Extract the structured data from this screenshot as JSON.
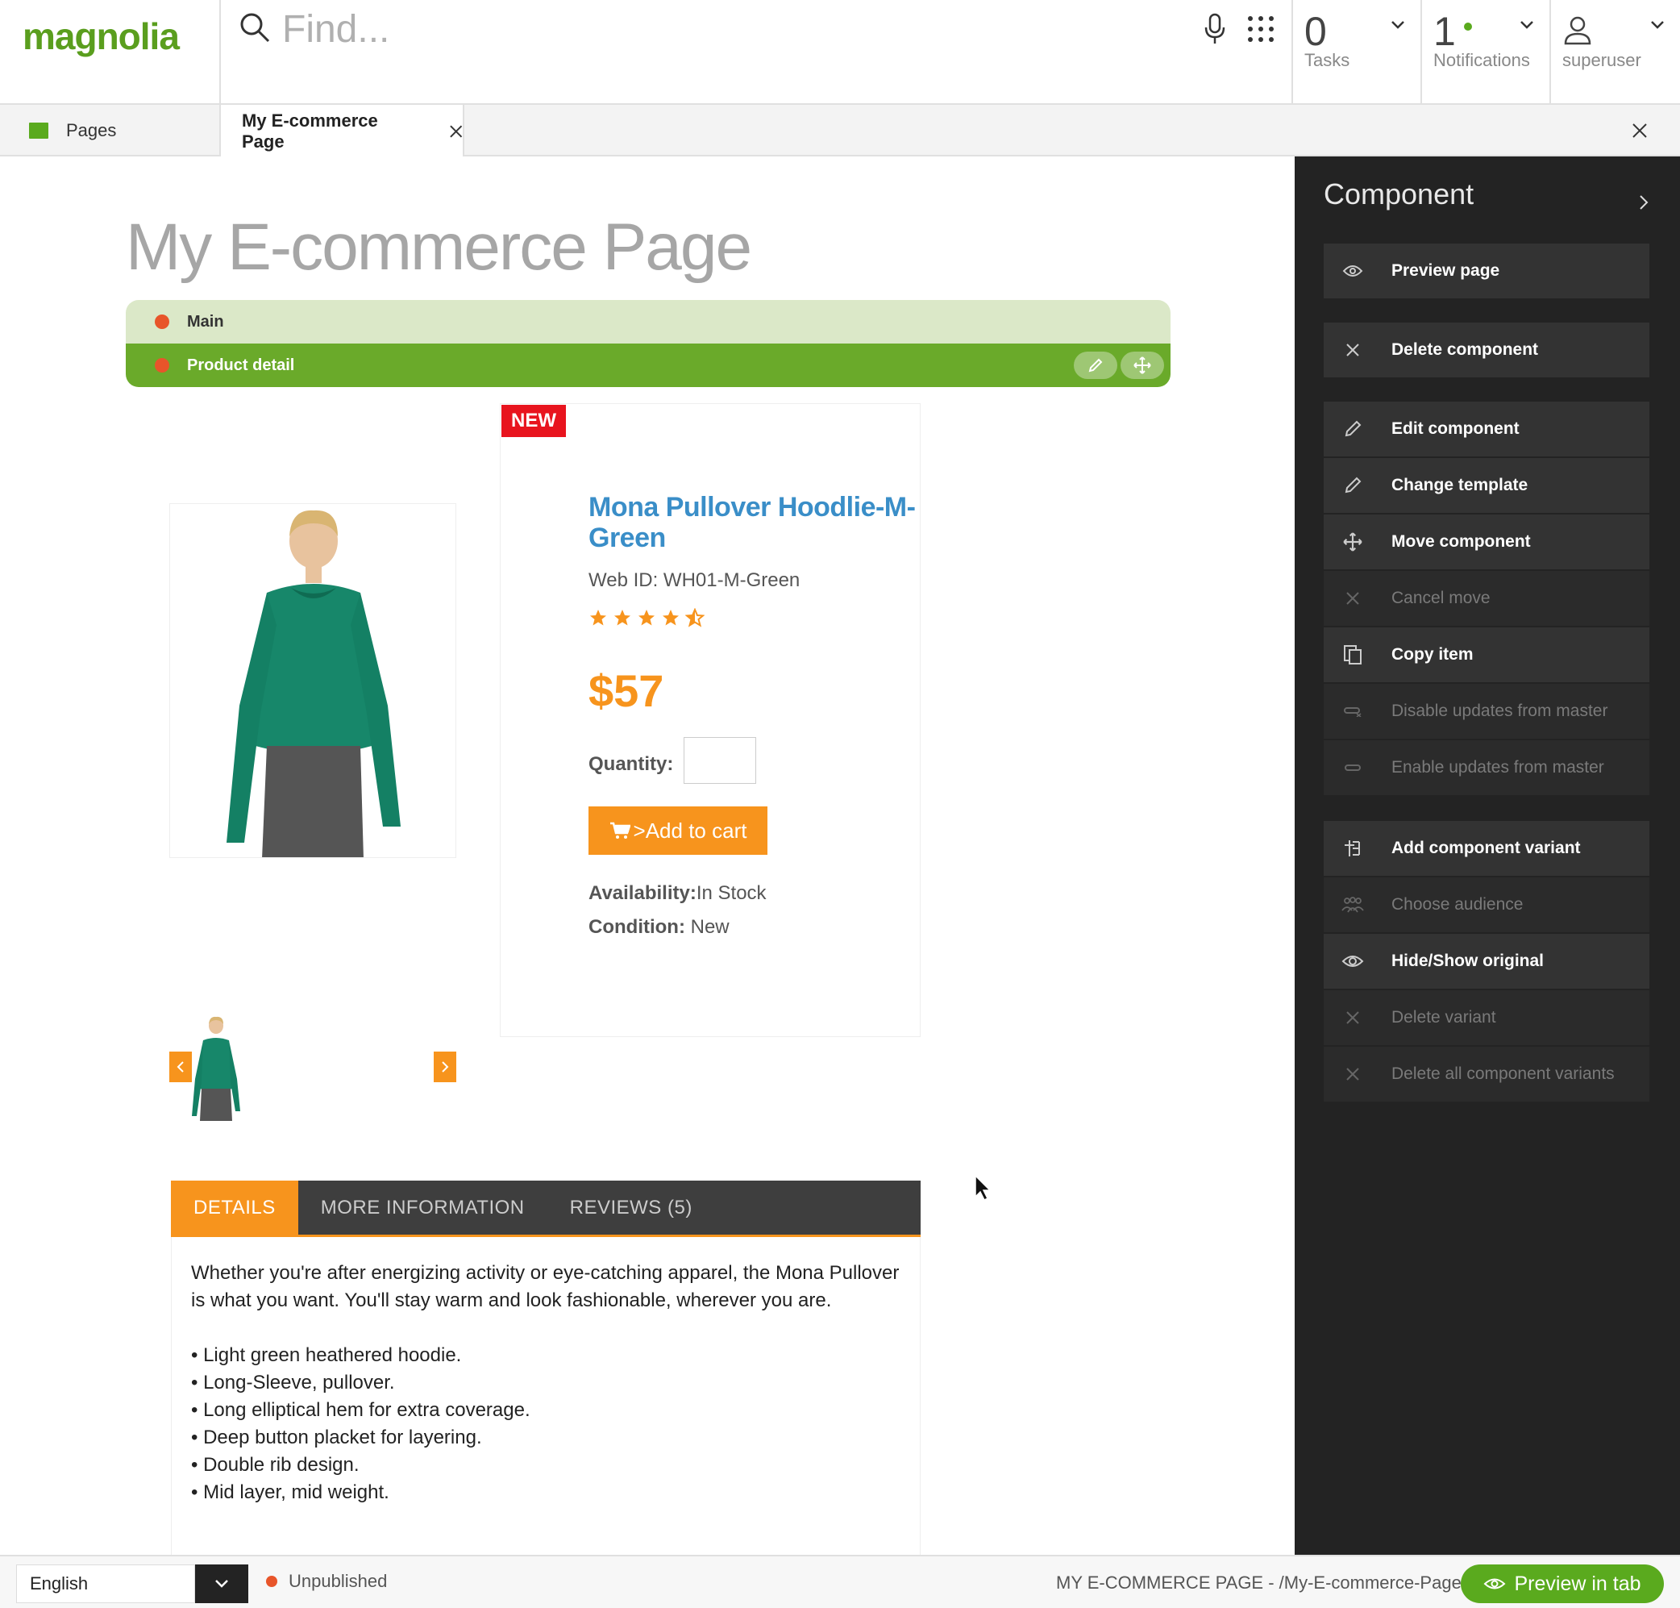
{
  "topbar": {
    "logo": "magnolia",
    "search_placeholder": "Find...",
    "tasks": {
      "count": "0",
      "label": "Tasks"
    },
    "notifications": {
      "count": "1",
      "label": "Notifications"
    },
    "user": {
      "label": "superuser"
    }
  },
  "tabs": {
    "pages_label": "Pages",
    "active_label": "My E-commerce Page"
  },
  "page": {
    "title": "My E-commerce Page",
    "area_label": "Main",
    "component_label": "Product detail",
    "badge": "NEW",
    "product_name": "Mona Pullover Hoodlie-M-Green",
    "web_id": "Web ID: WH01-M-Green",
    "rating": 4.5,
    "price": "$57",
    "quantity_label": "Quantity:",
    "quantity_value": "",
    "add_to_cart": ">Add to cart",
    "availability_label": "Availability:",
    "availability_value": "In Stock",
    "condition_label": "Condition:",
    "condition_value": "New",
    "product_tabs": [
      "DETAILS",
      "MORE INFORMATION",
      "REVIEWS (5)"
    ],
    "description": "Whether you're after energizing activity or eye-catching apparel, the Mona Pullover is what you want. You'll stay warm and look fashionable, wherever you are.",
    "features": [
      "Light green heathered hoodie.",
      "Long-Sleeve, pullover.",
      "Long elliptical hem for extra coverage.",
      "Deep button placket for layering.",
      "Double rib design.",
      "Mid layer, mid weight."
    ]
  },
  "panel": {
    "title": "Component",
    "actions": [
      {
        "label": "Preview page",
        "icon": "preview-icon",
        "enabled": true
      },
      {
        "label": "Delete component",
        "icon": "close-icon",
        "enabled": true
      },
      {
        "label": "Edit component",
        "icon": "pencil-icon",
        "enabled": true
      },
      {
        "label": "Change template",
        "icon": "pencil-icon",
        "enabled": true
      },
      {
        "label": "Move component",
        "icon": "move-icon",
        "enabled": true
      },
      {
        "label": "Cancel move",
        "icon": "close-icon",
        "enabled": false
      },
      {
        "label": "Copy item",
        "icon": "copy-icon",
        "enabled": true
      },
      {
        "label": "Disable updates from master",
        "icon": "unlink-icon",
        "enabled": false
      },
      {
        "label": "Enable updates from master",
        "icon": "link-icon",
        "enabled": false
      },
      {
        "label": "Add component variant",
        "icon": "add-variant-icon",
        "enabled": true
      },
      {
        "label": "Choose audience",
        "icon": "audience-icon",
        "enabled": false
      },
      {
        "label": "Hide/Show original",
        "icon": "eye-icon",
        "enabled": true
      },
      {
        "label": "Delete variant",
        "icon": "close-icon",
        "enabled": false
      },
      {
        "label": "Delete all component variants",
        "icon": "close-icon",
        "enabled": false
      }
    ]
  },
  "footer": {
    "language": "English",
    "status": "Unpublished",
    "path": "MY E-COMMERCE PAGE - /My-E-commerce-Page",
    "preview_button": "Preview in tab"
  },
  "colors": {
    "brand_green": "#5aaa1e",
    "accent_orange": "#f7941d",
    "link_blue": "#3a8ec8",
    "panel_bg": "#232323",
    "badge_red": "#e8141e"
  }
}
